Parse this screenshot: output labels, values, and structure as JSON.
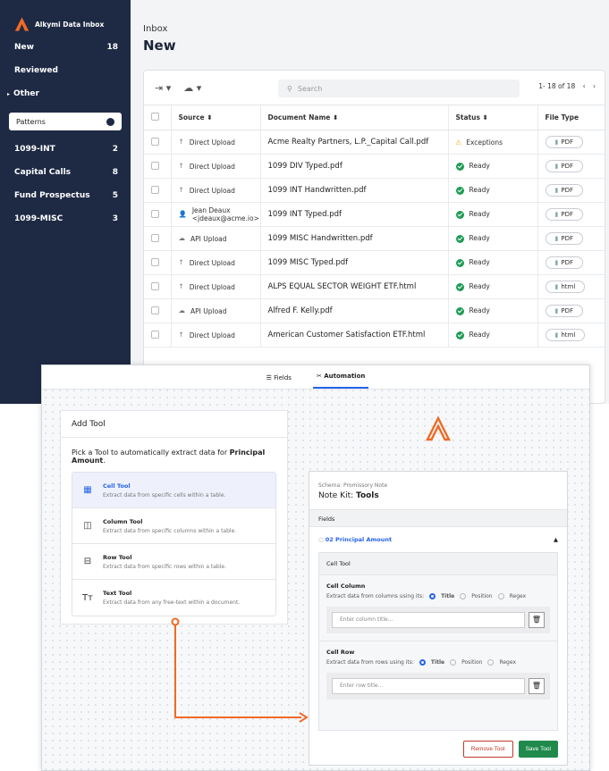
{
  "app": {
    "name": "Alkymi Data Inbox",
    "accent": "#f06a25"
  },
  "sidebar": {
    "items": [
      {
        "label": "New",
        "count": "18"
      },
      {
        "label": "Reviewed",
        "count": ""
      },
      {
        "label": "Other",
        "count": ""
      }
    ],
    "patterns_label": "Patterns",
    "patterns": [
      {
        "label": "1099-INT",
        "count": "2"
      },
      {
        "label": "Capital Calls",
        "count": "8"
      },
      {
        "label": "Fund Prospectus",
        "count": "5"
      },
      {
        "label": "1099-MISC",
        "count": "3"
      }
    ]
  },
  "header": {
    "breadcrumb": "Inbox",
    "title": "New"
  },
  "toolbar": {
    "search_placeholder": "Search",
    "pagination": "1- 18 of 18"
  },
  "table": {
    "columns": [
      "Source",
      "Document Name",
      "Status",
      "File Type"
    ],
    "rows": [
      {
        "source": "Direct Upload",
        "doc": "Acme Realty Partners, L.P._Capital Call.pdf",
        "status": "Exceptions",
        "type": "PDF"
      },
      {
        "source": "Direct Upload",
        "doc": "1099 DIV Typed.pdf",
        "status": "Ready",
        "type": "PDF"
      },
      {
        "source": "Direct Upload",
        "doc": "1099 INT Handwritten.pdf",
        "status": "Ready",
        "type": "PDF"
      },
      {
        "source": "Jean Deaux <jdeaux@acme.io>",
        "doc": "1099 INT Typed.pdf",
        "status": "Ready",
        "type": "PDF"
      },
      {
        "source": "API Upload",
        "doc": "1099 MISC Handwritten.pdf",
        "status": "Ready",
        "type": "PDF"
      },
      {
        "source": "Direct Upload",
        "doc": "1099 MISC Typed.pdf",
        "status": "Ready",
        "type": "PDF"
      },
      {
        "source": "Direct Upload",
        "doc": "ALPS EQUAL SECTOR WEIGHT ETF.html",
        "status": "Ready",
        "type": "html"
      },
      {
        "source": "API Upload",
        "doc": "Alfred F. Kelly.pdf",
        "status": "Ready",
        "type": "PDF"
      },
      {
        "source": "Direct Upload",
        "doc": "American Customer Satisfaction ETF.html",
        "status": "Ready",
        "type": "html"
      }
    ]
  },
  "panel": {
    "tabs": [
      "Fields",
      "Automation"
    ],
    "add_tool": {
      "title": "Add Tool",
      "desc_prefix": "Pick a Tool to automatically extract data for ",
      "desc_field": "Principal Amount",
      "desc_suffix": ".",
      "tools": [
        {
          "name": "Cell Tool",
          "desc": "Extract data from specific cells within a table."
        },
        {
          "name": "Column Tool",
          "desc": "Extract data from specific columns within a table."
        },
        {
          "name": "Row Tool",
          "desc": "Extract data from specific rows within a table."
        },
        {
          "name": "Text Tool",
          "desc": "Extract data from any free-text within a document."
        }
      ]
    },
    "schema": {
      "label": "Schema: Promissory Note",
      "kit_prefix": "Note Kit: ",
      "kit_name": "Tools",
      "fields_label": "Fields",
      "field": "02  Principal Amount",
      "cell_tool": "Cell Tool",
      "column": {
        "title": "Cell Column",
        "desc": "Extract data from columns using its:",
        "opts": [
          "Title",
          "Position",
          "Regex"
        ],
        "placeholder": "Enter column title..."
      },
      "row": {
        "title": "Cell Row",
        "desc": "Extract data from rows using its:",
        "opts": [
          "Title",
          "Position",
          "Regex"
        ],
        "placeholder": "Enter row title..."
      },
      "remove": "Remove Tool",
      "save": "Save Tool"
    }
  }
}
